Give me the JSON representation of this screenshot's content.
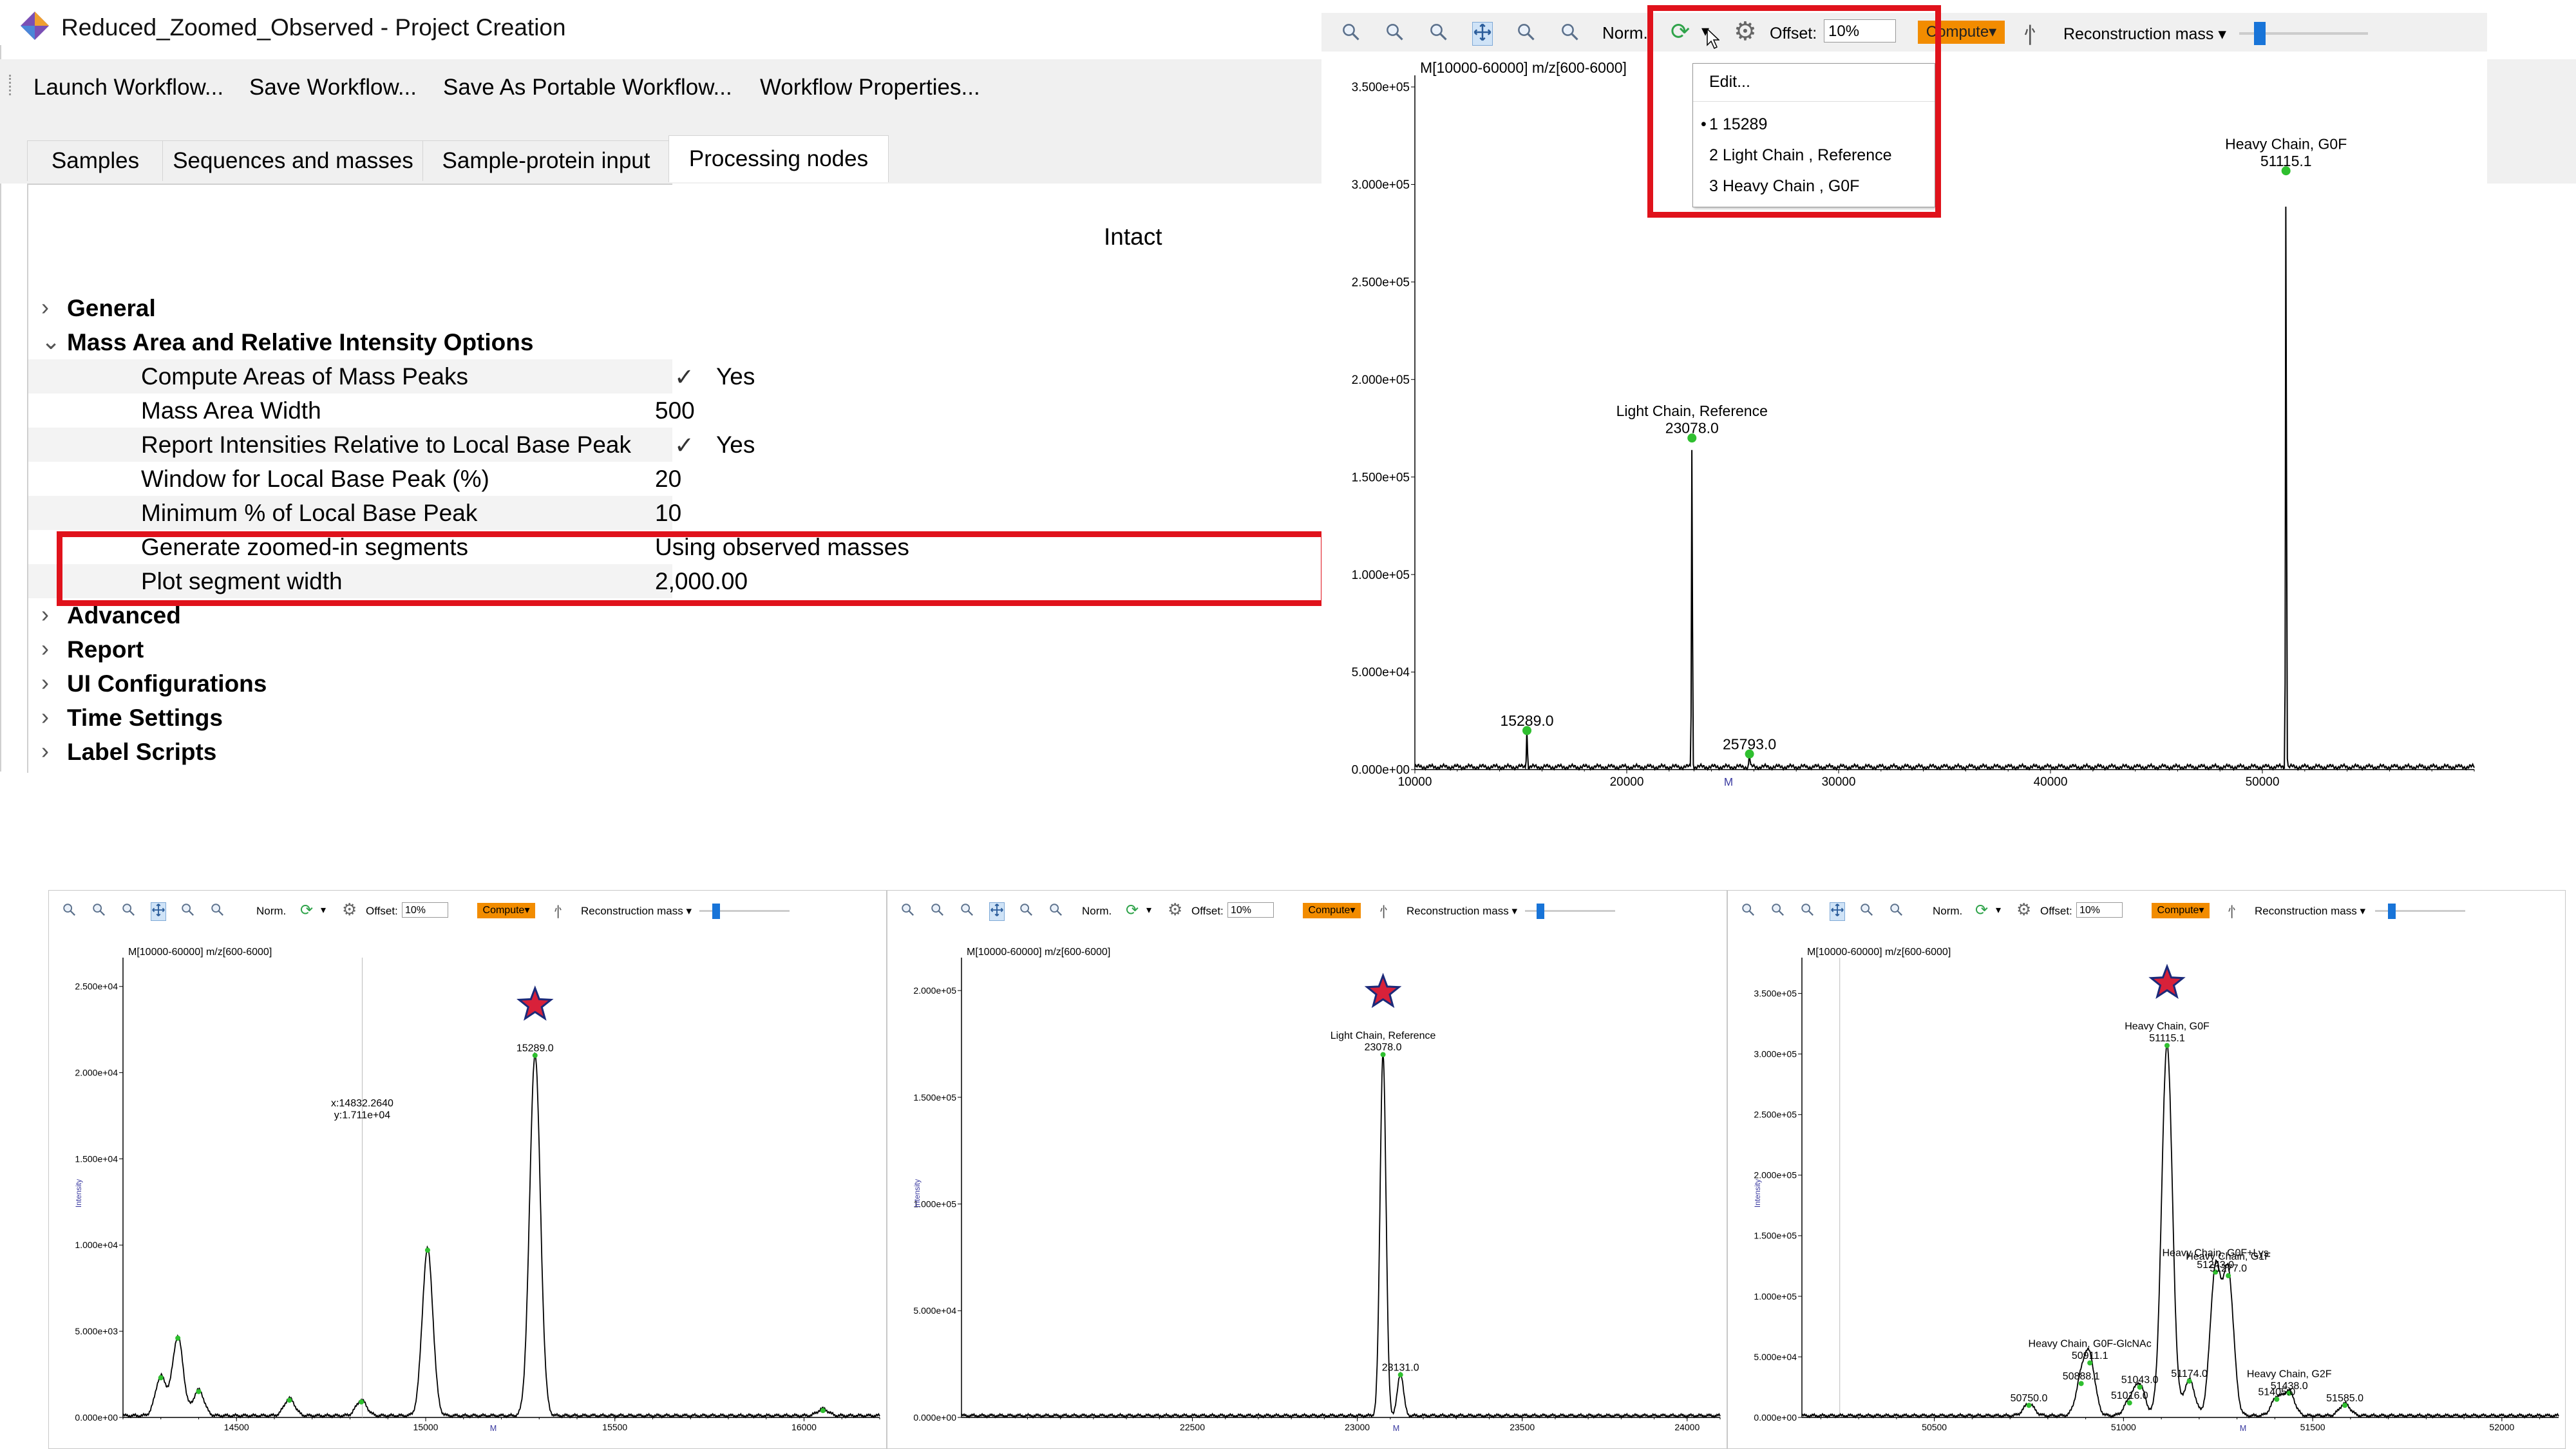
{
  "window": {
    "title": "Reduced_Zoomed_Observed - Project Creation"
  },
  "toolbar": {
    "launch": "Launch Workflow...",
    "save": "Save Workflow...",
    "save_portable": "Save As Portable Workflow...",
    "properties": "Workflow Properties..."
  },
  "tabs": [
    "Samples",
    "Sequences and masses",
    "Sample-protein input",
    "Processing nodes"
  ],
  "panel": {
    "column_header": "Intact",
    "sections": {
      "general": "General",
      "mass_area": "Mass Area and Relative Intensity Options",
      "advanced": "Advanced",
      "report": "Report",
      "ui_config": "UI Configurations",
      "time_settings": "Time Settings",
      "label_scripts": "Label Scripts"
    },
    "options": [
      {
        "label": "Compute Areas of Mass Peaks",
        "value": "Yes",
        "check": "✓"
      },
      {
        "label": "Mass Area Width",
        "value": "500"
      },
      {
        "label": "Report Intensities Relative to Local Base Peak",
        "value": "Yes",
        "check": "✓"
      },
      {
        "label": "Window for Local Base Peak (%)",
        "value": "20"
      },
      {
        "label": "Minimum % of Local Base Peak",
        "value": "10"
      },
      {
        "label": "Generate zoomed-in segments",
        "value": "Using observed masses"
      },
      {
        "label": "Plot segment width",
        "value": "2,000.00"
      }
    ]
  },
  "chart_toolbar": {
    "norm": "Norm.",
    "offset_label": "Offset:",
    "offset_value": "10%",
    "compute": "Compute",
    "reconstruction": "Reconstruction mass"
  },
  "dropdown": {
    "items": [
      "Edit...",
      "1 15289",
      "2 Light Chain , Reference",
      "3 Heavy Chain , G0F"
    ],
    "selected_marker": "•"
  },
  "colors": {
    "highlight": "#e0121b",
    "peak_marker": "#2fbf2f",
    "compute_button": "#f28c00",
    "star_fill": "#d8213a",
    "star_stroke": "#1b2a7a",
    "axis_label": "#3a3aa0",
    "slider_handle": "#1874d8"
  },
  "chart_data": [
    {
      "type": "line",
      "title": "M[10000-60000] m/z[600-6000]",
      "xlabel": "",
      "ylabel": "",
      "xlim": [
        10000,
        60000
      ],
      "ylim": [
        0,
        350000
      ],
      "x_ticks": [
        10000,
        20000,
        30000,
        40000,
        50000
      ],
      "y_ticks": [
        0,
        50000,
        100000,
        150000,
        200000,
        250000,
        300000,
        350000
      ],
      "y_tick_labels": [
        "0.000e+00",
        "5.000e+04",
        "1.000e+05",
        "1.500e+05",
        "2.000e+05",
        "2.500e+05",
        "3.000e+05",
        "3.500e+05"
      ],
      "x_marker": "M",
      "peaks": [
        {
          "x": 15289,
          "y": 20000
        },
        {
          "x": 23078,
          "y": 170000
        },
        {
          "x": 25793,
          "y": 8000
        },
        {
          "x": 51115.1,
          "y": 307000
        }
      ],
      "annotations": [
        {
          "x": 15289,
          "y": 20000,
          "lines": [
            "15289.0"
          ]
        },
        {
          "x": 23078,
          "y": 170000,
          "lines": [
            "Light Chain, Reference",
            "23078.0"
          ]
        },
        {
          "x": 25793,
          "y": 8000,
          "lines": [
            "25793.0"
          ]
        },
        {
          "x": 51115.1,
          "y": 307000,
          "lines": [
            "Heavy Chain, G0F",
            "51115.1"
          ]
        }
      ]
    },
    {
      "type": "line",
      "title": "M[10000-60000] m/z[600-6000]",
      "ylabel": "Intensity",
      "xlim": [
        14200,
        16200
      ],
      "ylim": [
        0,
        26000
      ],
      "x_ticks": [
        14500,
        15000,
        15500,
        16000
      ],
      "y_ticks": [
        0,
        5000,
        10000,
        15000,
        20000,
        25000
      ],
      "y_tick_labels": [
        "0.000e+00",
        "5.000e+03",
        "1.000e+04",
        "1.500e+04",
        "2.000e+04",
        "2.500e+04"
      ],
      "x_marker": "M",
      "peaks": [
        {
          "x": 14300,
          "y": 2300
        },
        {
          "x": 14345,
          "y": 4600
        },
        {
          "x": 14400,
          "y": 1500
        },
        {
          "x": 14640,
          "y": 1000
        },
        {
          "x": 14830,
          "y": 900
        },
        {
          "x": 15005,
          "y": 9700
        },
        {
          "x": 15289,
          "y": 21000
        },
        {
          "x": 16050,
          "y": 400
        }
      ],
      "annotations": [
        {
          "x": 15289,
          "y": 21000,
          "lines": [
            "15289.0"
          ]
        },
        {
          "x": 14832.264,
          "y": 17110,
          "lines": [
            "x:14832.2640",
            "y:1.711e+04"
          ]
        }
      ],
      "cursor_x": 14832.264,
      "star_x": 15289
    },
    {
      "type": "line",
      "title": "M[10000-60000] m/z[600-6000]",
      "ylabel": "Intensity",
      "xlim": [
        21800,
        24100
      ],
      "ylim": [
        0,
        210000
      ],
      "x_ticks": [
        22500,
        23000,
        23500,
        24000
      ],
      "y_ticks": [
        0,
        50000,
        100000,
        150000,
        200000
      ],
      "y_tick_labels": [
        "0.000e+00",
        "5.000e+04",
        "1.000e+05",
        "1.500e+05",
        "2.000e+05"
      ],
      "x_marker": "M",
      "peaks": [
        {
          "x": 23078,
          "y": 170000
        },
        {
          "x": 23131,
          "y": 20000
        }
      ],
      "annotations": [
        {
          "x": 23078,
          "y": 170000,
          "lines": [
            "Light Chain, Reference",
            "23078.0"
          ]
        },
        {
          "x": 23131,
          "y": 20000,
          "lines": [
            "23131.0"
          ]
        }
      ],
      "star_x": 23078
    },
    {
      "type": "line",
      "title": "M[10000-60000] m/z[600-6000]",
      "ylabel": "Intensity",
      "xlim": [
        50150,
        52150
      ],
      "ylim": [
        0,
        370000
      ],
      "x_ticks": [
        50500,
        51000,
        51500,
        52000
      ],
      "y_ticks": [
        0,
        50000,
        100000,
        150000,
        200000,
        250000,
        300000,
        350000
      ],
      "y_tick_labels": [
        "0.000e+00",
        "5.000e+04",
        "1.000e+05",
        "1.500e+05",
        "2.000e+05",
        "2.500e+05",
        "3.000e+05",
        "3.500e+05"
      ],
      "x_marker": "M",
      "peaks": [
        {
          "x": 50750,
          "y": 10000
        },
        {
          "x": 50888.1,
          "y": 28000
        },
        {
          "x": 50911.1,
          "y": 45000
        },
        {
          "x": 51016,
          "y": 12000
        },
        {
          "x": 51043,
          "y": 25000
        },
        {
          "x": 51115.1,
          "y": 307000
        },
        {
          "x": 51174,
          "y": 30000
        },
        {
          "x": 51243,
          "y": 120000
        },
        {
          "x": 51277,
          "y": 117000
        },
        {
          "x": 51405,
          "y": 15000
        },
        {
          "x": 51438,
          "y": 20000
        },
        {
          "x": 51585,
          "y": 10000
        }
      ],
      "annotations": [
        {
          "x": 51115.1,
          "y": 307000,
          "lines": [
            "Heavy Chain, G0F",
            "51115.1"
          ]
        },
        {
          "x": 50911.1,
          "y": 45000,
          "lines": [
            "Heavy Chain, G0F-GlcNAc",
            "50911.1"
          ]
        },
        {
          "x": 50888.1,
          "y": 28000,
          "lines": [
            "50888.1"
          ]
        },
        {
          "x": 50750,
          "y": 10000,
          "lines": [
            "50750.0"
          ]
        },
        {
          "x": 51016,
          "y": 12000,
          "lines": [
            "51016.0"
          ]
        },
        {
          "x": 51043,
          "y": 25000,
          "lines": [
            "51043.0"
          ]
        },
        {
          "x": 51174,
          "y": 30000,
          "lines": [
            "51174.0"
          ]
        },
        {
          "x": 51243,
          "y": 120000,
          "lines": [
            "Heavy Chain, G0F+Lys",
            "51243.0"
          ]
        },
        {
          "x": 51277,
          "y": 117000,
          "lines": [
            "Heavy Chain, G1F",
            "51277.0"
          ]
        },
        {
          "x": 51405,
          "y": 15000,
          "lines": [
            "51405.0"
          ]
        },
        {
          "x": 51438,
          "y": 20000,
          "lines": [
            "Heavy Chain, G2F",
            "51438.0"
          ]
        },
        {
          "x": 51585,
          "y": 10000,
          "lines": [
            "51585.0"
          ]
        }
      ],
      "cursor_x": 50250,
      "star_x": 51115.1
    }
  ]
}
